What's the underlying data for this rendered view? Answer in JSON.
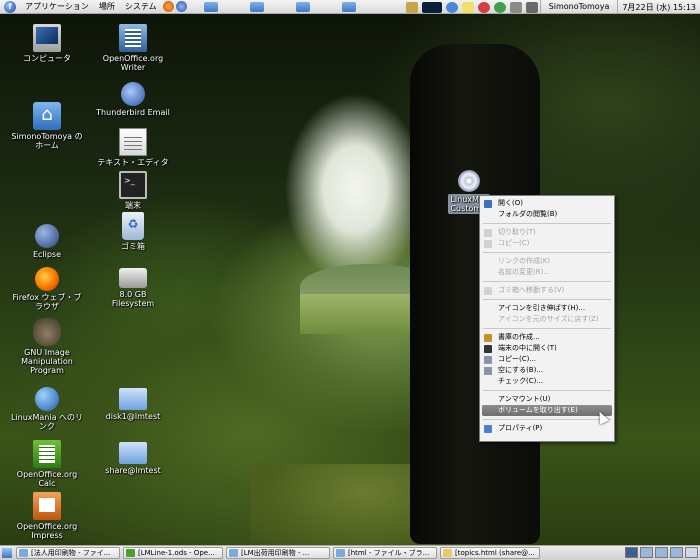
{
  "top_panel": {
    "menus": [
      "アプリケーション",
      "場所",
      "システム"
    ],
    "user": "SimonoTomoya",
    "clock": "7月22日 (水) 15:13"
  },
  "desktop": {
    "icons_left": [
      {
        "name": "computer",
        "label": "コンピュータ",
        "icon": "monitor-icon"
      },
      {
        "name": "home",
        "label": "SimonoTomoya の\nホーム",
        "icon": "home-folder-icon"
      },
      {
        "name": "eclipse",
        "label": "Eclipse",
        "icon": "eclipse-icon"
      },
      {
        "name": "firefox",
        "label": "Firefox ウェブ・ブ\nラウザ",
        "icon": "firefox-icon"
      },
      {
        "name": "gimp",
        "label": "GNU Image\nManipulation\nProgram",
        "icon": "gimp-icon"
      },
      {
        "name": "linuxmania-link",
        "label": "LinuxMania へのリ\nンク",
        "icon": "globe-icon"
      },
      {
        "name": "oo-calc",
        "label": "OpenOffice.org\nCalc",
        "icon": "spreadsheet-icon"
      },
      {
        "name": "oo-impress",
        "label": "OpenOffice.org\nImpress",
        "icon": "presentation-icon"
      }
    ],
    "icons_right": [
      {
        "name": "oo-writer",
        "label": "OpenOffice.org\nWriter",
        "icon": "document-icon"
      },
      {
        "name": "thunderbird",
        "label": "Thunderbird Email",
        "icon": "thunderbird-icon"
      },
      {
        "name": "text-editor",
        "label": "テキスト・エディタ",
        "icon": "text-editor-icon"
      },
      {
        "name": "terminal",
        "label": "端末",
        "icon": "terminal-icon"
      },
      {
        "name": "trash",
        "label": "ゴミ箱",
        "icon": "trash-icon"
      },
      {
        "name": "filesystem",
        "label": "8.0 GB\nFilesystem",
        "icon": "drive-icon"
      },
      {
        "name": "disk1",
        "label": "disk1@lmtest",
        "icon": "folder-icon"
      },
      {
        "name": "share",
        "label": "share@lmtest",
        "icon": "folder-icon"
      }
    ],
    "cd_icon_label": "LinuxMa\nCustomiz"
  },
  "context_menu": {
    "items": [
      {
        "label": "開く(O)",
        "disabled": false,
        "icon": "open-icon"
      },
      {
        "label": "フォルダの閲覧(B)",
        "disabled": false,
        "icon": ""
      },
      {
        "sep": true
      },
      {
        "label": "切り取り(T)",
        "disabled": true,
        "icon": "cut-icon"
      },
      {
        "label": "コピー(C)",
        "disabled": true,
        "icon": "copy-icon"
      },
      {
        "sep": true
      },
      {
        "label": "リンクの作成(K)",
        "disabled": true,
        "icon": ""
      },
      {
        "label": "名前の変更(R)...",
        "disabled": true,
        "icon": ""
      },
      {
        "sep": true
      },
      {
        "label": "ゴミ箱へ移動する(V)",
        "disabled": true,
        "icon": "trash-icon"
      },
      {
        "sep": true
      },
      {
        "label": "アイコンを引き伸ばす(H)...",
        "disabled": false,
        "icon": ""
      },
      {
        "label": "アイコンを元のサイズに戻す(Z)",
        "disabled": true,
        "icon": ""
      },
      {
        "sep": true
      },
      {
        "label": "書庫の作成...",
        "disabled": false,
        "icon": "archive-icon"
      },
      {
        "label": "端末の中に開く(T)",
        "disabled": false,
        "icon": "terminal-icon"
      },
      {
        "label": "コピー(C)...",
        "disabled": false,
        "icon": "copy-disc-icon"
      },
      {
        "label": "空にする(B)...",
        "disabled": false,
        "icon": "erase-icon"
      },
      {
        "label": "チェック(C)...",
        "disabled": false,
        "icon": ""
      },
      {
        "sep": true
      },
      {
        "label": "アンマウント(U)",
        "disabled": false,
        "icon": ""
      },
      {
        "label": "ボリュームを取り出す(E)",
        "disabled": false,
        "icon": "",
        "highlight": true
      },
      {
        "sep": true
      },
      {
        "label": "プロパティ(P)",
        "disabled": false,
        "icon": "properties-icon"
      }
    ]
  },
  "taskbar": {
    "tasks": [
      "[法人用印刷物 - ファイ...",
      "[LMLine-1.ods - Ope...",
      "[LM出荷用印刷物 - ...",
      "[html - ファイル・ブラ...",
      "[topics.html (share@..."
    ]
  },
  "colors": {
    "menu_highlight": "#7a7a7a",
    "panel_bg": "#e4e4e4",
    "selection_label": "#8a94a4"
  }
}
